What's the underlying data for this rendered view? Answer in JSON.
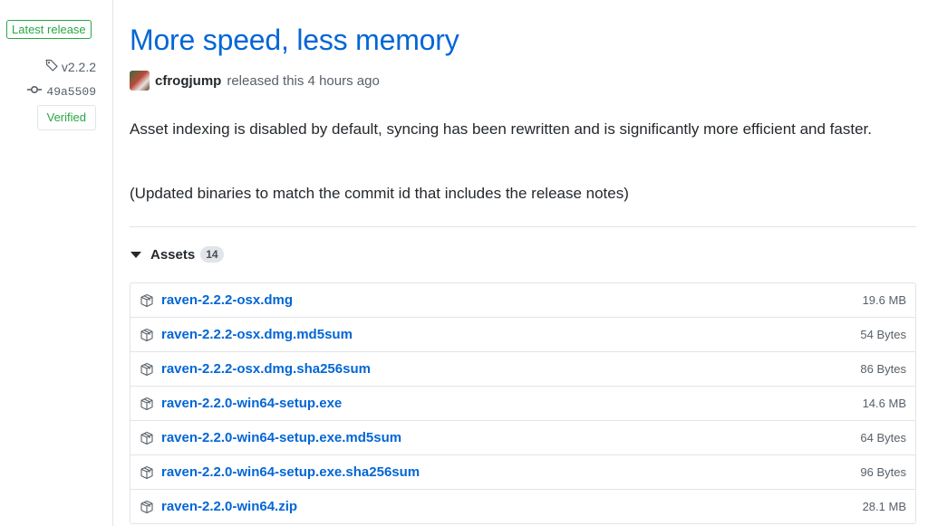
{
  "sidebar": {
    "latest_badge": "Latest release",
    "tag": "v2.2.2",
    "commit": "49a5509",
    "verified": "Verified"
  },
  "release": {
    "title": "More speed, less memory",
    "author": "cfrogjump",
    "released_text": "released this 4 hours ago",
    "body_p1": "Asset indexing is disabled by default, syncing has been rewritten and is significantly more efficient and faster.",
    "body_p2": "(Updated binaries to match the commit id that includes the release notes)"
  },
  "assets": {
    "label": "Assets",
    "count": "14",
    "items": [
      {
        "name": "raven-2.2.2-osx.dmg",
        "size": "19.6 MB"
      },
      {
        "name": "raven-2.2.2-osx.dmg.md5sum",
        "size": "54 Bytes"
      },
      {
        "name": "raven-2.2.2-osx.dmg.sha256sum",
        "size": "86 Bytes"
      },
      {
        "name": "raven-2.2.0-win64-setup.exe",
        "size": "14.6 MB"
      },
      {
        "name": "raven-2.2.0-win64-setup.exe.md5sum",
        "size": "64 Bytes"
      },
      {
        "name": "raven-2.2.0-win64-setup.exe.sha256sum",
        "size": "96 Bytes"
      },
      {
        "name": "raven-2.2.0-win64.zip",
        "size": "28.1 MB"
      }
    ]
  },
  "colors": {
    "link": "#0366d6",
    "verified_green": "#28a745",
    "border": "#e1e4e8"
  },
  "icons": {
    "tag": "tag-icon",
    "commit": "git-commit-icon",
    "asset": "package-icon",
    "caret": "triangle-down-icon"
  }
}
